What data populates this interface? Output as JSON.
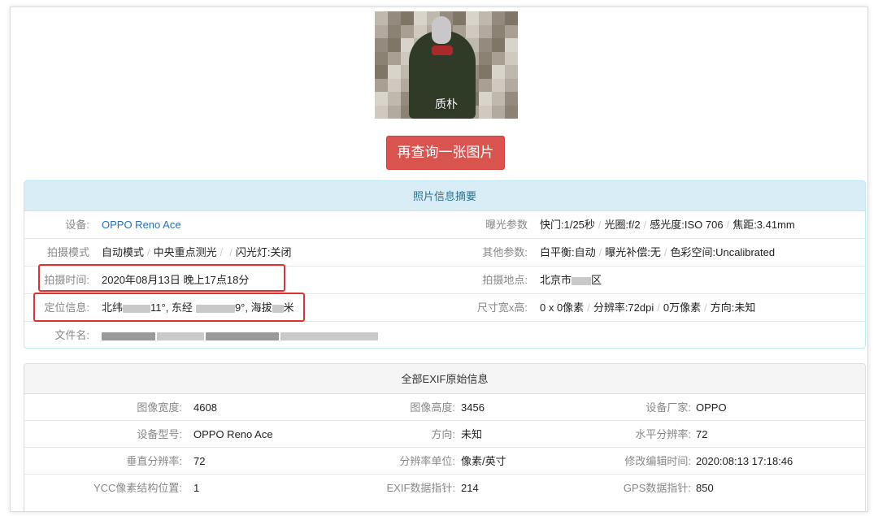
{
  "photo": {
    "caption": "质朴"
  },
  "requery_button": "再查询一张图片",
  "summary": {
    "title": "照片信息摘要",
    "rows": [
      {
        "left_label": "设备:",
        "left_value": "OPPO Reno Ace",
        "right_label": "曝光参数",
        "right_values": [
          "快门:1/25秒",
          "光圈:f/2",
          "感光度:ISO 706",
          "焦距:3.41mm"
        ]
      },
      {
        "left_label": "拍摄模式",
        "left_values": [
          "自动模式",
          "中央重点测光",
          "",
          "闪光灯:关闭"
        ],
        "right_label": "其他参数:",
        "right_values": [
          "白平衡:自动",
          "曝光补偿:无",
          "色彩空间:Uncalibrated"
        ]
      },
      {
        "left_label": "拍摄时间:",
        "left_value": "2020年08月13日 晚上17点18分",
        "right_label": "拍摄地点:",
        "right_value_prefix": "北京市",
        "right_value_suffix": "区"
      },
      {
        "left_label": "定位信息:",
        "loc_a": "北纬",
        "loc_b": "11°, 东经",
        "loc_c": "9°, 海拔",
        "loc_d": "米",
        "right_label": "尺寸宽x高:",
        "right_values": [
          "0 x 0像素",
          "分辨率:72dpi",
          "0万像素",
          "方向:未知"
        ]
      },
      {
        "left_label": "文件名:"
      }
    ]
  },
  "exif": {
    "title": "全部EXIF原始信息",
    "rows": [
      [
        {
          "label": "图像宽度:",
          "value": "4608"
        },
        {
          "label": "图像高度:",
          "value": "3456"
        },
        {
          "label": "设备厂家:",
          "value": "OPPO"
        }
      ],
      [
        {
          "label": "设备型号:",
          "value": "OPPO Reno Ace"
        },
        {
          "label": "方向:",
          "value": "未知"
        },
        {
          "label": "水平分辨率:",
          "value": "72"
        }
      ],
      [
        {
          "label": "垂直分辨率:",
          "value": "72"
        },
        {
          "label": "分辨率单位:",
          "value": "像素/英寸"
        },
        {
          "label": "修改编辑时间:",
          "value": "2020:08:13 17:18:46"
        }
      ],
      [
        {
          "label": "YCC像素结构位置:",
          "value": "1"
        },
        {
          "label": "EXIF数据指针:",
          "value": "214"
        },
        {
          "label": "GPS数据指针:",
          "value": "850"
        }
      ]
    ]
  },
  "colors": {
    "danger": "#d9534f",
    "info_bg": "#d9edf7",
    "info_text": "#31708f",
    "link": "#2a6fb5",
    "highlight": "#e03131"
  }
}
